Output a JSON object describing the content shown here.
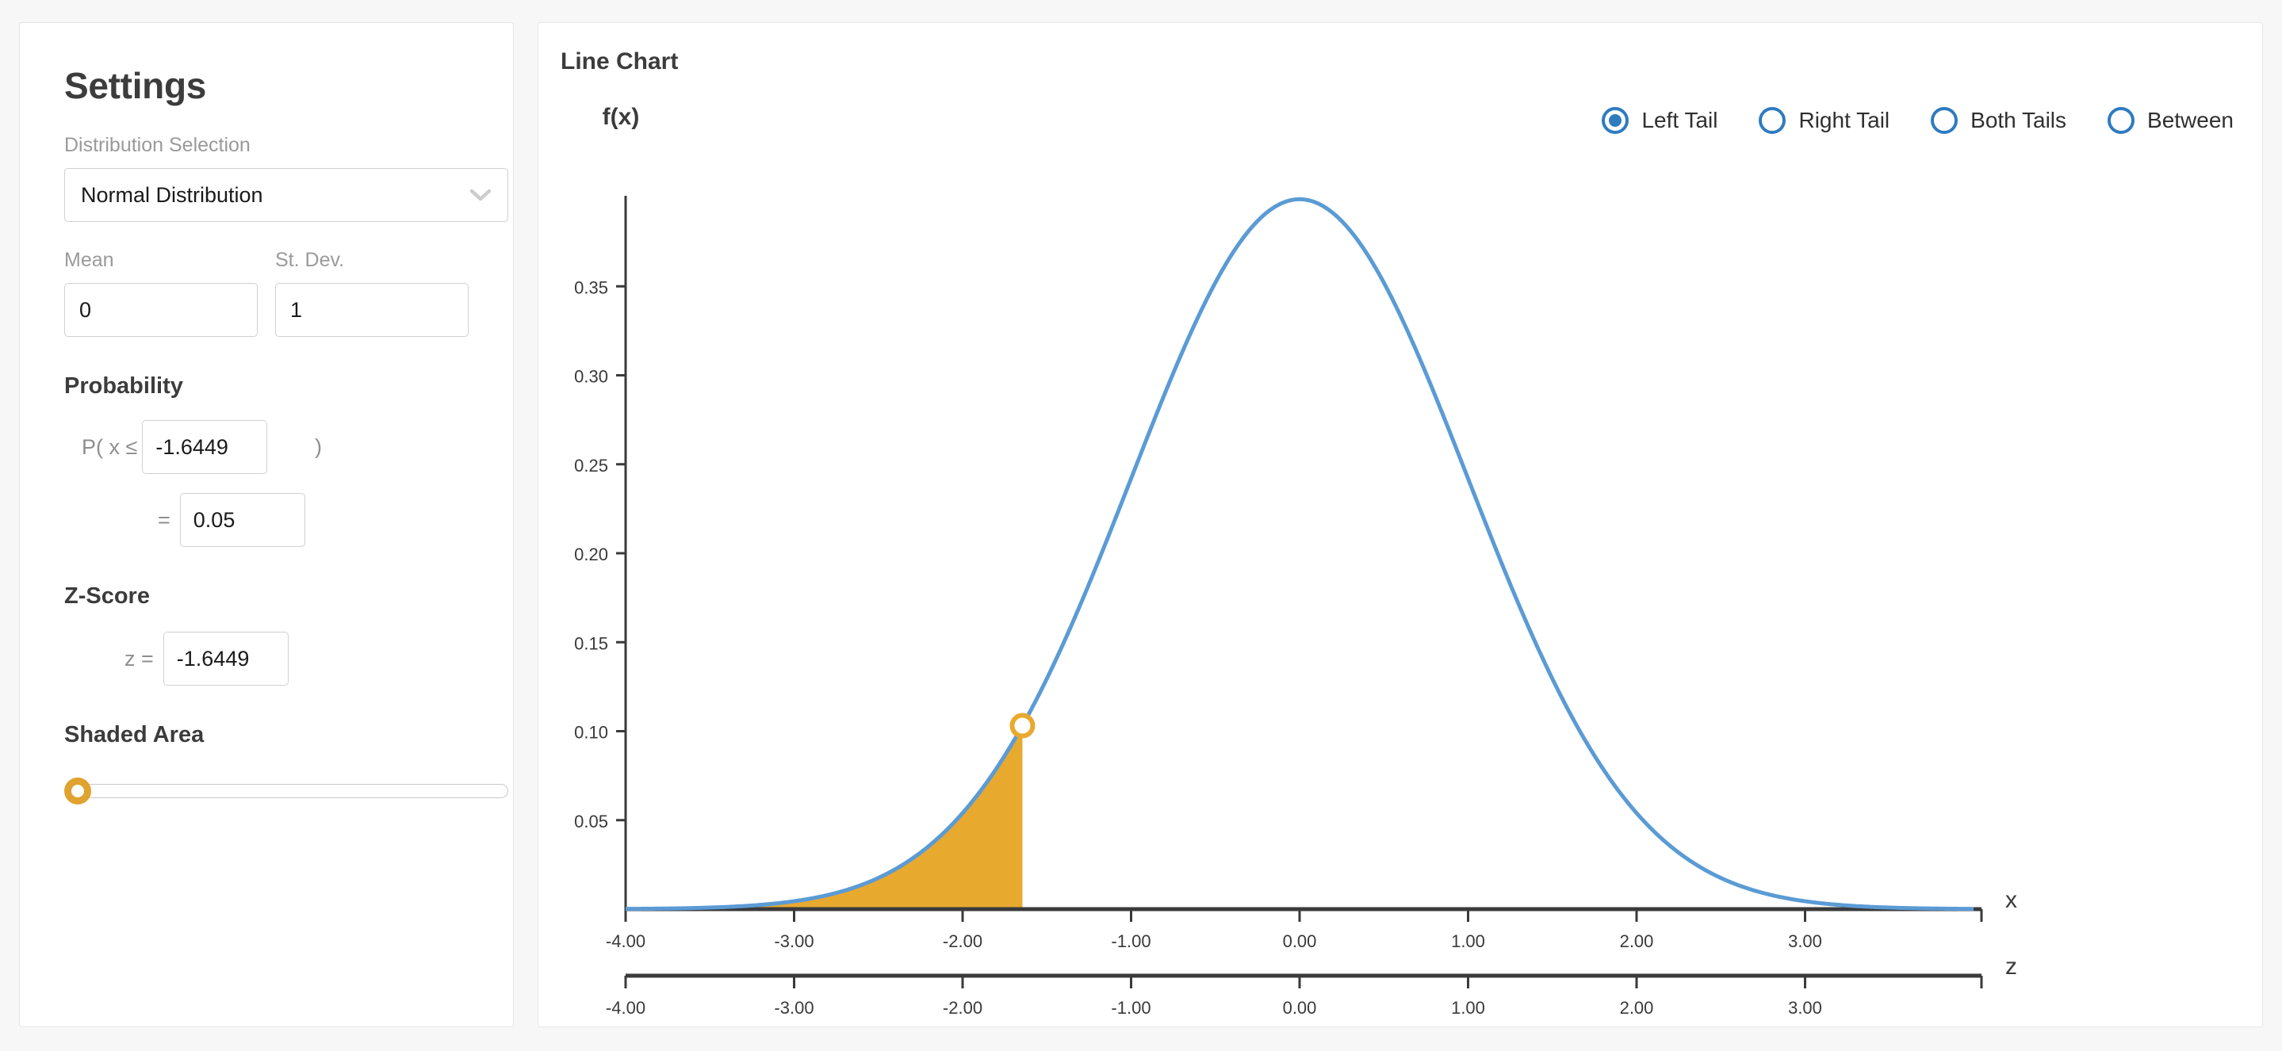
{
  "sidebar": {
    "title": "Settings",
    "distribution": {
      "label": "Distribution Selection",
      "selected": "Normal Distribution",
      "options": [
        "Normal Distribution"
      ],
      "icon": "chevron-down-icon"
    },
    "mean": {
      "label": "Mean",
      "value": "0"
    },
    "stdev": {
      "label": "St. Dev.",
      "value": "1"
    },
    "probability": {
      "heading": "Probability",
      "prefix": "P( x ≤",
      "suffix": ")",
      "x_value": "-1.6449",
      "equals": "=",
      "p_value": "0.05"
    },
    "zscore": {
      "heading": "Z-Score",
      "label": "z =",
      "value": "-1.6449"
    },
    "shaded_area": {
      "heading": "Shaded Area",
      "slider_value": 0,
      "slider_min": 0,
      "slider_max": 100
    }
  },
  "chart_panel": {
    "title": "Line Chart",
    "tail_options": [
      {
        "label": "Left Tail",
        "selected": true
      },
      {
        "label": "Right Tail",
        "selected": false
      },
      {
        "label": "Both Tails",
        "selected": false
      },
      {
        "label": "Between",
        "selected": false
      }
    ]
  },
  "colors": {
    "curve_blue": "#5b9bd5",
    "shade_orange": "#e8a92f",
    "radio_blue": "#2f7bbf",
    "axis_dark": "#3a3a3a",
    "panel_bg": "#ffffff",
    "page_bg": "#f7f7f7"
  },
  "chart_data": {
    "type": "line",
    "title": "Line Chart",
    "xlabel": "x",
    "ylabel": "f(x)",
    "secondary_xlabel": "z",
    "xlim": [
      -4.0,
      4.0
    ],
    "ylim": [
      0.0,
      0.4
    ],
    "grid": false,
    "x_ticks": [
      "-4.00",
      "-3.00",
      "-2.00",
      "-1.00",
      "0.00",
      "1.00",
      "2.00",
      "3.00"
    ],
    "x_tick_values": [
      -4,
      -3,
      -2,
      -1,
      0,
      1,
      2,
      3
    ],
    "z_ticks": [
      "-4.00",
      "-3.00",
      "-2.00",
      "-1.00",
      "0.00",
      "1.00",
      "2.00",
      "3.00"
    ],
    "z_tick_values": [
      -4,
      -3,
      -2,
      -1,
      0,
      1,
      2,
      3
    ],
    "y_ticks": [
      "0.05",
      "0.10",
      "0.15",
      "0.20",
      "0.25",
      "0.30",
      "0.35"
    ],
    "y_tick_values": [
      0.05,
      0.1,
      0.15,
      0.2,
      0.25,
      0.3,
      0.35
    ],
    "series": [
      {
        "name": "Normal Distribution PDF",
        "distribution": "normal",
        "mean": 0,
        "stdev": 1,
        "color": "#5b9bd5"
      }
    ],
    "shaded_region": {
      "type": "left-tail",
      "from": -4.0,
      "to": -1.6449,
      "area": 0.05,
      "color": "#e8a92f"
    },
    "marker": {
      "x": -1.6449,
      "y": 0.1031,
      "color": "#e8a92f",
      "style": "open-circle"
    }
  }
}
